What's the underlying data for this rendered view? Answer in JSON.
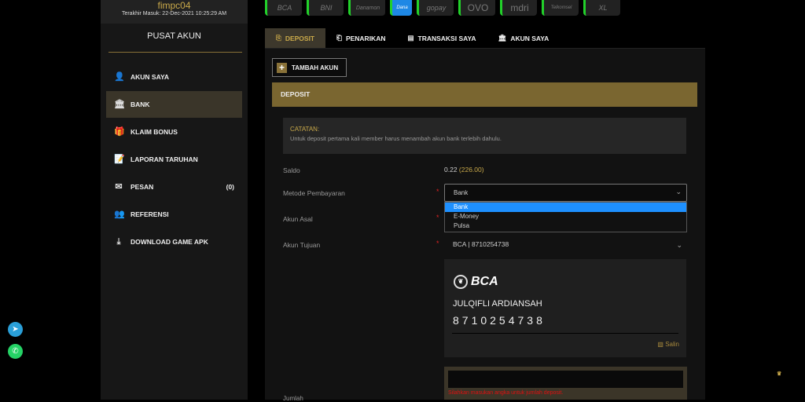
{
  "user": {
    "name": "fimpc04",
    "last_login": "Terakhir Masuk: 22-Dec-2021 10:25:29 AM"
  },
  "sidebar": {
    "title": "PUSAT AKUN",
    "items": [
      {
        "label": "AKUN SAYA",
        "icon": "user-icon"
      },
      {
        "label": "BANK",
        "icon": "bank-icon"
      },
      {
        "label": "KLAIM BONUS",
        "icon": "gift-icon"
      },
      {
        "label": "LAPORAN TARUHAN",
        "icon": "report-icon"
      },
      {
        "label": "PESAN",
        "icon": "mail-icon",
        "count": "(0)"
      },
      {
        "label": "REFERENSI",
        "icon": "users-icon"
      },
      {
        "label": "DOWNLOAD GAME APK",
        "icon": "download-icon"
      }
    ]
  },
  "banks": [
    "BCA",
    "BNI",
    "Danamon",
    "Dana",
    "gopay",
    "OVO",
    "mdri",
    "Telkomsel",
    "XL"
  ],
  "tabs": [
    {
      "label": "DEPOSIT"
    },
    {
      "label": "PENARIKAN"
    },
    {
      "label": "TRANSAKSI SAYA"
    },
    {
      "label": "AKUN SAYA"
    }
  ],
  "tambah_akun": "TAMBAH AKUN",
  "section_title": "DEPOSIT",
  "note": {
    "title": "CATATAN:",
    "body": "Untuk deposit pertama kali member harus menambah akun bank terlebih dahulu."
  },
  "form": {
    "saldo_label": "Saldo",
    "saldo_value": "0.22",
    "saldo_sub": "(226.00)",
    "metode_label": "Metode Pembayaran",
    "metode_value": "Bank",
    "metode_options": [
      "Bank",
      "E-Money",
      "Pulsa"
    ],
    "akun_asal_label": "Akun Asal",
    "akun_tujuan_label": "Akun Tujuan",
    "akun_tujuan_value": "BCA | 8710254738",
    "jumlah_label": "Jumlah",
    "jumlah_error": "Silahkan masukan angka untuk jumlah deposit.",
    "required": "*"
  },
  "card": {
    "bank": "BCA",
    "holder": "JULQIFLI ARDIANSAH",
    "number": "8710254738",
    "copy": "Salin"
  },
  "colors": {
    "accent": "#c9a94a",
    "active_green": "#22d12a",
    "error": "#e01010"
  }
}
